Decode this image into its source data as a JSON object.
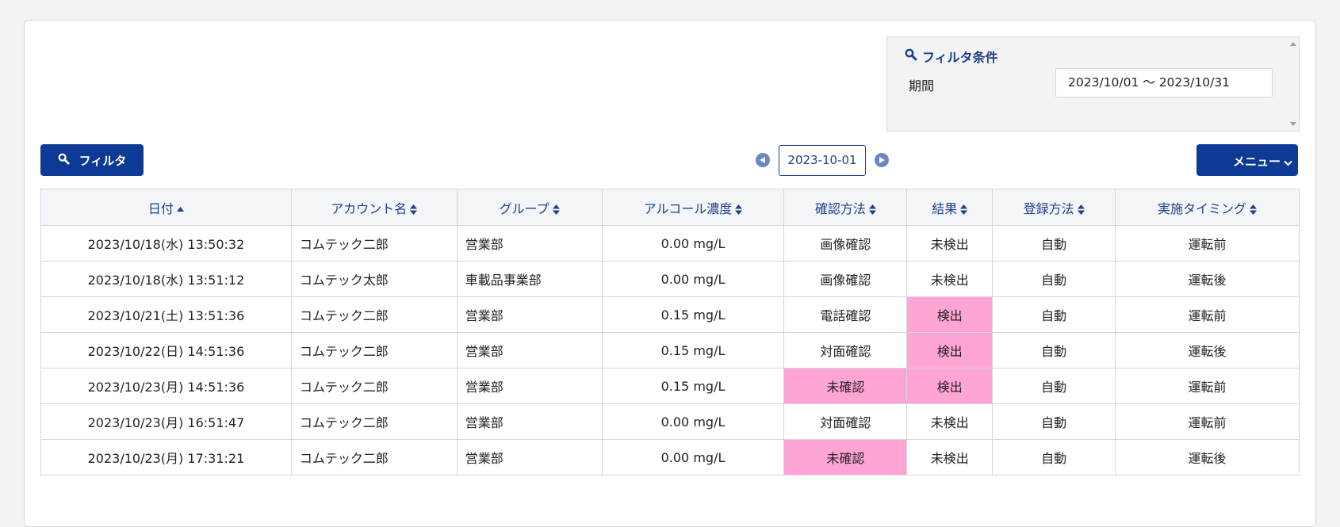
{
  "filter_conditions": {
    "title": "フィルタ条件",
    "period_label": "期間",
    "period_value": "2023/10/01 〜 2023/10/31"
  },
  "toolbar": {
    "filter_label": "フィルタ",
    "current_date": "2023-10-01",
    "menu_label": "メニュー"
  },
  "table": {
    "columns": [
      {
        "label": "日付",
        "sort": "asc"
      },
      {
        "label": "アカウント名",
        "sort": "both"
      },
      {
        "label": "グループ",
        "sort": "both"
      },
      {
        "label": "アルコール濃度",
        "sort": "both"
      },
      {
        "label": "確認方法",
        "sort": "both"
      },
      {
        "label": "結果",
        "sort": "both"
      },
      {
        "label": "登録方法",
        "sort": "both"
      },
      {
        "label": "実施タイミング",
        "sort": "both"
      }
    ],
    "rows": [
      {
        "date": "2023/10/18(水) 13:50:32",
        "account": "コムテック二郎",
        "group": "営業部",
        "alcohol": "0.00 mg/L",
        "method": "画像確認",
        "method_alert": false,
        "result": "未検出",
        "result_alert": false,
        "registration": "自動",
        "timing": "運転前"
      },
      {
        "date": "2023/10/18(水) 13:51:12",
        "account": "コムテック太郎",
        "group": "車載品事業部",
        "alcohol": "0.00 mg/L",
        "method": "画像確認",
        "method_alert": false,
        "result": "未検出",
        "result_alert": false,
        "registration": "自動",
        "timing": "運転後"
      },
      {
        "date": "2023/10/21(土) 13:51:36",
        "account": "コムテック二郎",
        "group": "営業部",
        "alcohol": "0.15 mg/L",
        "method": "電話確認",
        "method_alert": false,
        "result": "検出",
        "result_alert": true,
        "registration": "自動",
        "timing": "運転前"
      },
      {
        "date": "2023/10/22(日) 14:51:36",
        "account": "コムテック二郎",
        "group": "営業部",
        "alcohol": "0.15 mg/L",
        "method": "対面確認",
        "method_alert": false,
        "result": "検出",
        "result_alert": true,
        "registration": "自動",
        "timing": "運転後"
      },
      {
        "date": "2023/10/23(月) 14:51:36",
        "account": "コムテック二郎",
        "group": "営業部",
        "alcohol": "0.15 mg/L",
        "method": "未確認",
        "method_alert": true,
        "result": "検出",
        "result_alert": true,
        "registration": "自動",
        "timing": "運転前"
      },
      {
        "date": "2023/10/23(月) 16:51:47",
        "account": "コムテック二郎",
        "group": "営業部",
        "alcohol": "0.00 mg/L",
        "method": "対面確認",
        "method_alert": false,
        "result": "未検出",
        "result_alert": false,
        "registration": "自動",
        "timing": "運転前"
      },
      {
        "date": "2023/10/23(月) 17:31:21",
        "account": "コムテック二郎",
        "group": "営業部",
        "alcohol": "0.00 mg/L",
        "method": "未確認",
        "method_alert": true,
        "result": "未検出",
        "result_alert": false,
        "registration": "自動",
        "timing": "運転後"
      }
    ]
  },
  "colors": {
    "primary": "#0c3a94",
    "header_text": "#1f3f8a",
    "alert": "#ffa5d5"
  },
  "icons": {
    "filter_button": "search-icon",
    "filter_title": "search-icon",
    "prev": "arrow-left-circle-icon",
    "next": "arrow-right-circle-icon",
    "menu": "chevron-down-icon"
  }
}
